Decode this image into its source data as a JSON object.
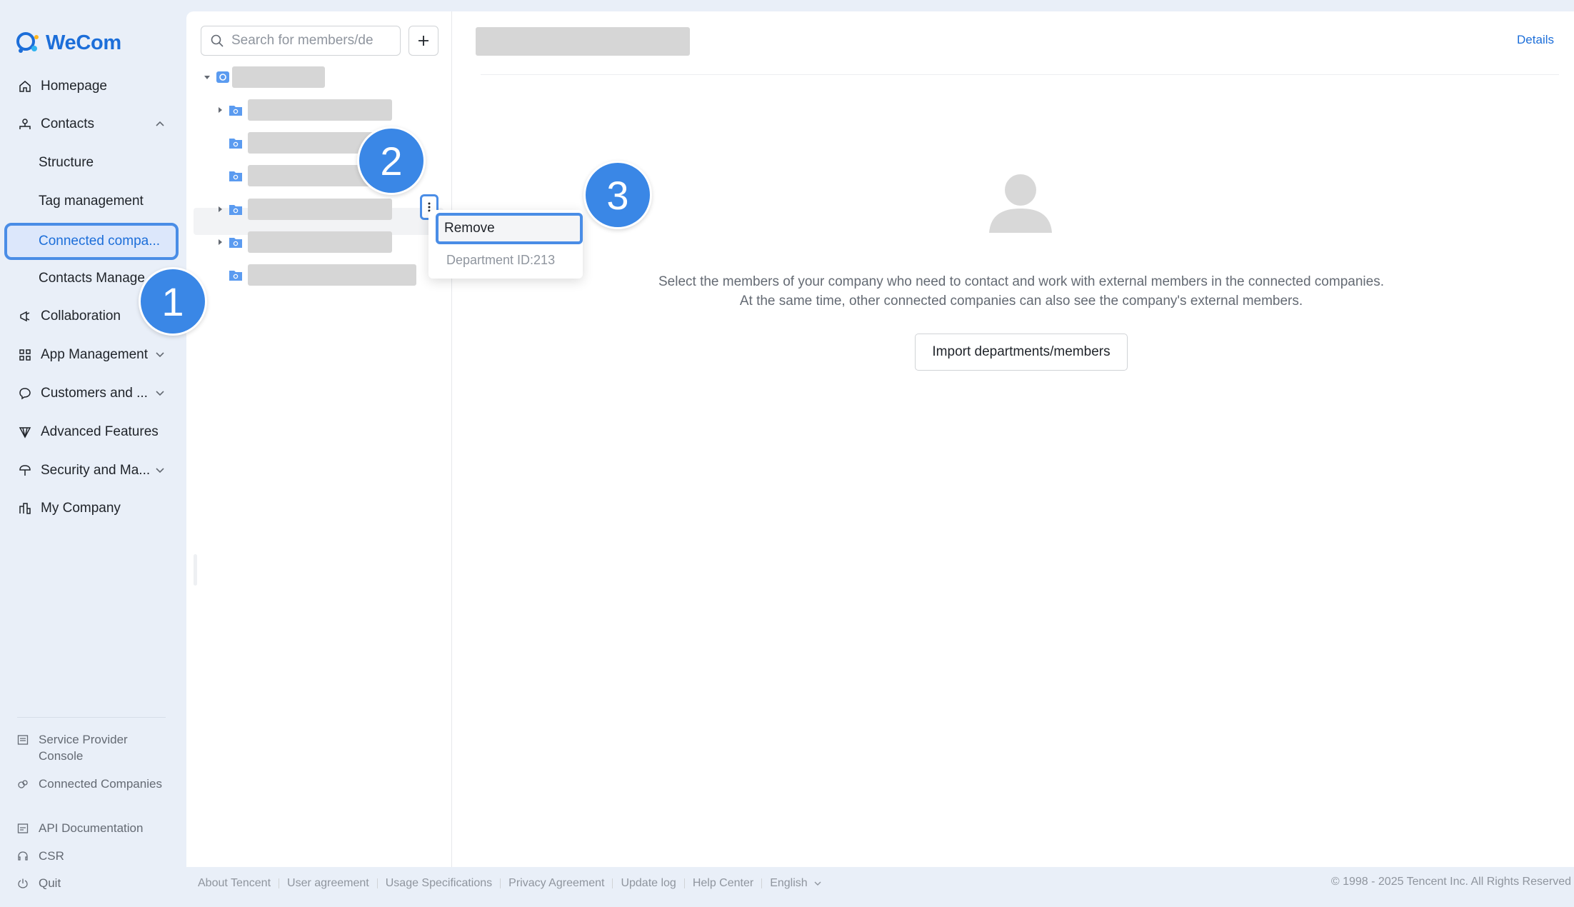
{
  "brand": {
    "name": "WeCom",
    "color": "#1c6ed9"
  },
  "nav": {
    "homepage": "Homepage",
    "contacts": "Contacts",
    "structure": "Structure",
    "tag_management": "Tag management",
    "connected_companies": "Connected compa...",
    "contacts_management": "Contacts Manage",
    "collaboration": "Collaboration",
    "app_management": "App Management",
    "customers": "Customers and ...",
    "advanced_features": "Advanced Features",
    "security": "Security and Ma...",
    "my_company": "My Company"
  },
  "bottom_nav": {
    "service_provider": "Service Provider Console",
    "connected": "Connected Companies",
    "api_docs": "API Documentation",
    "csr": "CSR",
    "quit": "Quit"
  },
  "search": {
    "placeholder": "Search for members/de"
  },
  "context_menu": {
    "remove": "Remove",
    "department_id": "Department ID:213"
  },
  "content": {
    "details": "Details",
    "empty_line1": "Select the members of your company who need to contact and work with external members in the connected companies.",
    "empty_line2": "At the same time, other connected companies can also see the company's external members.",
    "import_button": "Import departments/members"
  },
  "footer": {
    "links": [
      "About Tencent",
      "User agreement",
      "Usage Specifications",
      "Privacy Agreement",
      "Update log",
      "Help Center"
    ],
    "language": "English",
    "copyright": "© 1998 - 2025 Tencent Inc. All Rights Reserved"
  },
  "badges": [
    "1",
    "2",
    "3"
  ],
  "colors": {
    "accent": "#1c6ed9",
    "highlight_border": "#4a8de6",
    "badge": "#3a87e6"
  }
}
